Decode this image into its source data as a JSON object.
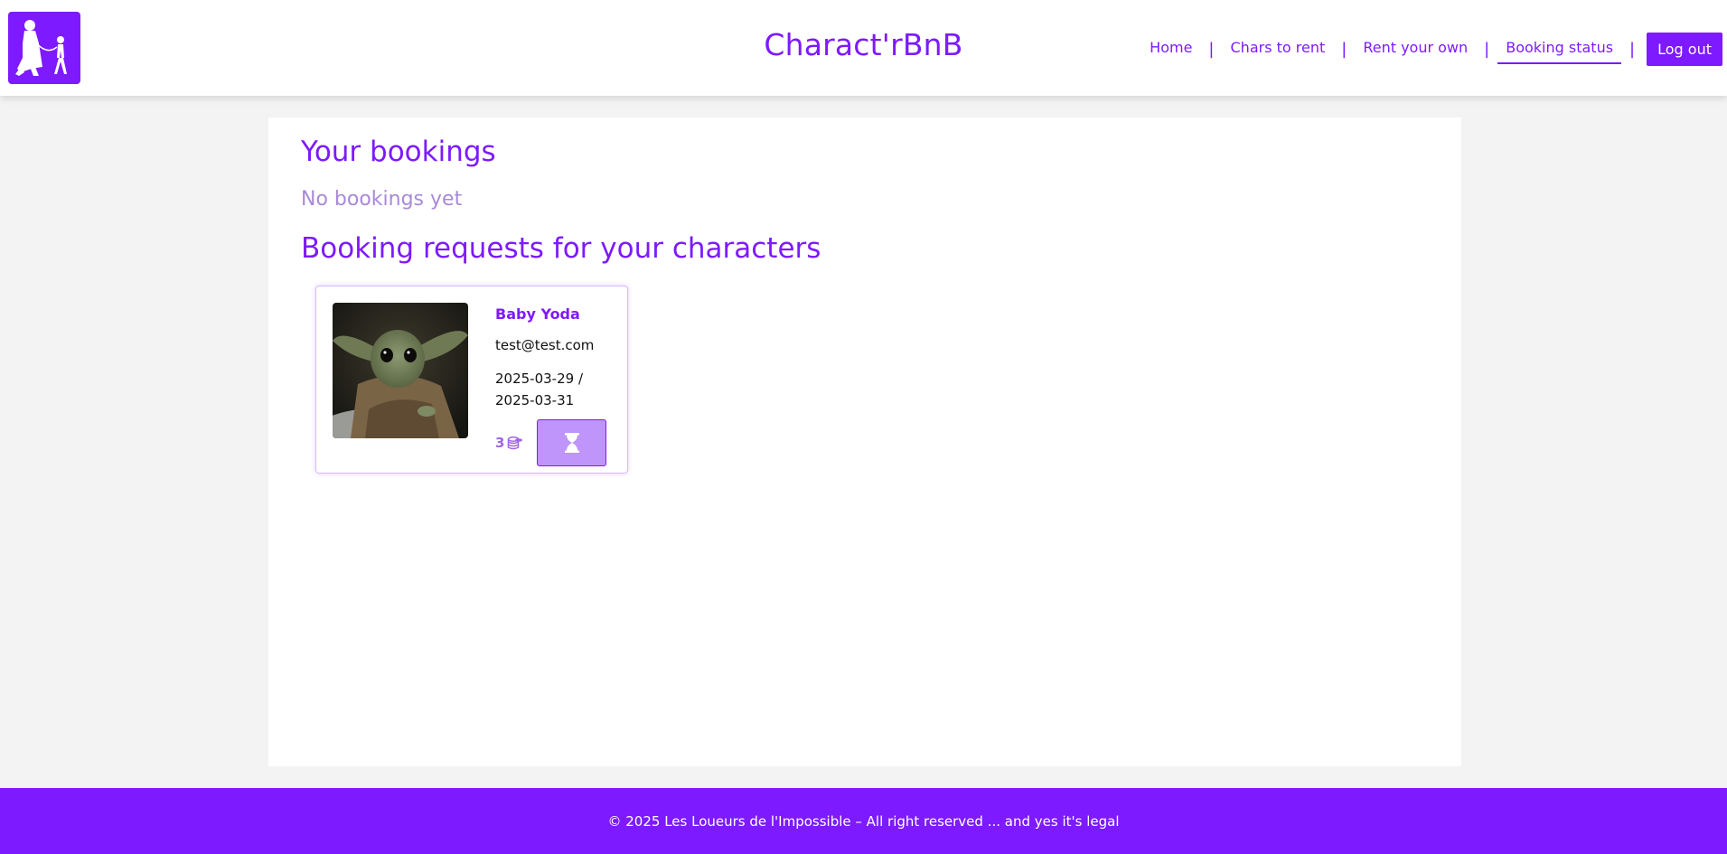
{
  "header": {
    "site_title": "Charact'rBnB",
    "logo_icon": "person-walking-character-icon",
    "nav": [
      {
        "label": "Home",
        "active": false
      },
      {
        "label": "Chars to rent",
        "active": false
      },
      {
        "label": "Rent your own",
        "active": false
      },
      {
        "label": "Booking status",
        "active": true
      }
    ],
    "separator": "|",
    "logout_label": "Log out"
  },
  "main": {
    "bookings_title": "Your bookings",
    "bookings_empty": "No bookings yet",
    "requests_title": "Booking requests for your characters",
    "requests": [
      {
        "character_name": "Baby Yoda",
        "requester_email": "test@test.com",
        "dates": "2025-03-29 / 2025-03-31",
        "price": "3",
        "price_icon": "coins-icon",
        "status_icon": "hourglass-icon",
        "image_alt": "baby-yoda-photo"
      }
    ]
  },
  "footer": {
    "text": "© 2025 Les Loueurs de l'Impossible – All right reserved ... and yes it's legal"
  },
  "colors": {
    "accent": "#7d1aff",
    "muted_text": "#a88ad8",
    "button_light": "#bf94fb"
  }
}
